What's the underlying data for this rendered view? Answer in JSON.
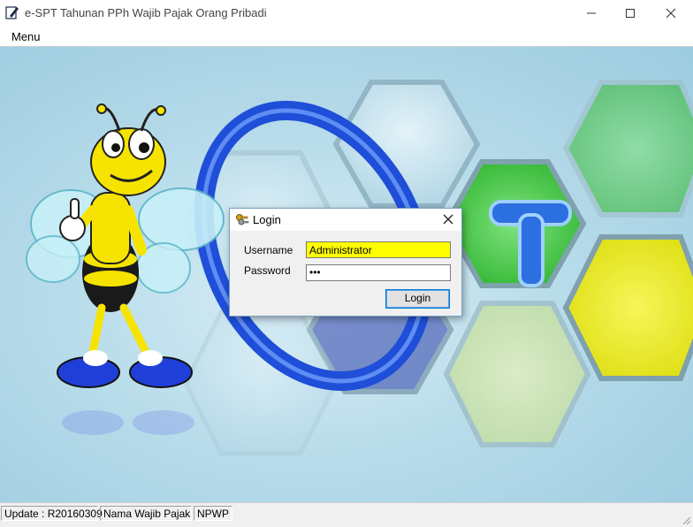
{
  "window": {
    "title": "e-SPT Tahunan PPh Wajib Pajak Orang Pribadi",
    "menu": "Menu"
  },
  "login_dialog": {
    "title": "Login",
    "username_label": "Username",
    "username_value": "Administrator",
    "password_label": "Password",
    "password_value": "•••",
    "login_button": "Login"
  },
  "statusbar": {
    "update": "Update : R20160309",
    "taxpayer_name": "Nama Wajib Pajak",
    "npwp": "NPWP"
  },
  "colors": {
    "username_highlight": "#ffff00",
    "logo_blue": "#1f4fd8",
    "background": "#b8dcea"
  }
}
